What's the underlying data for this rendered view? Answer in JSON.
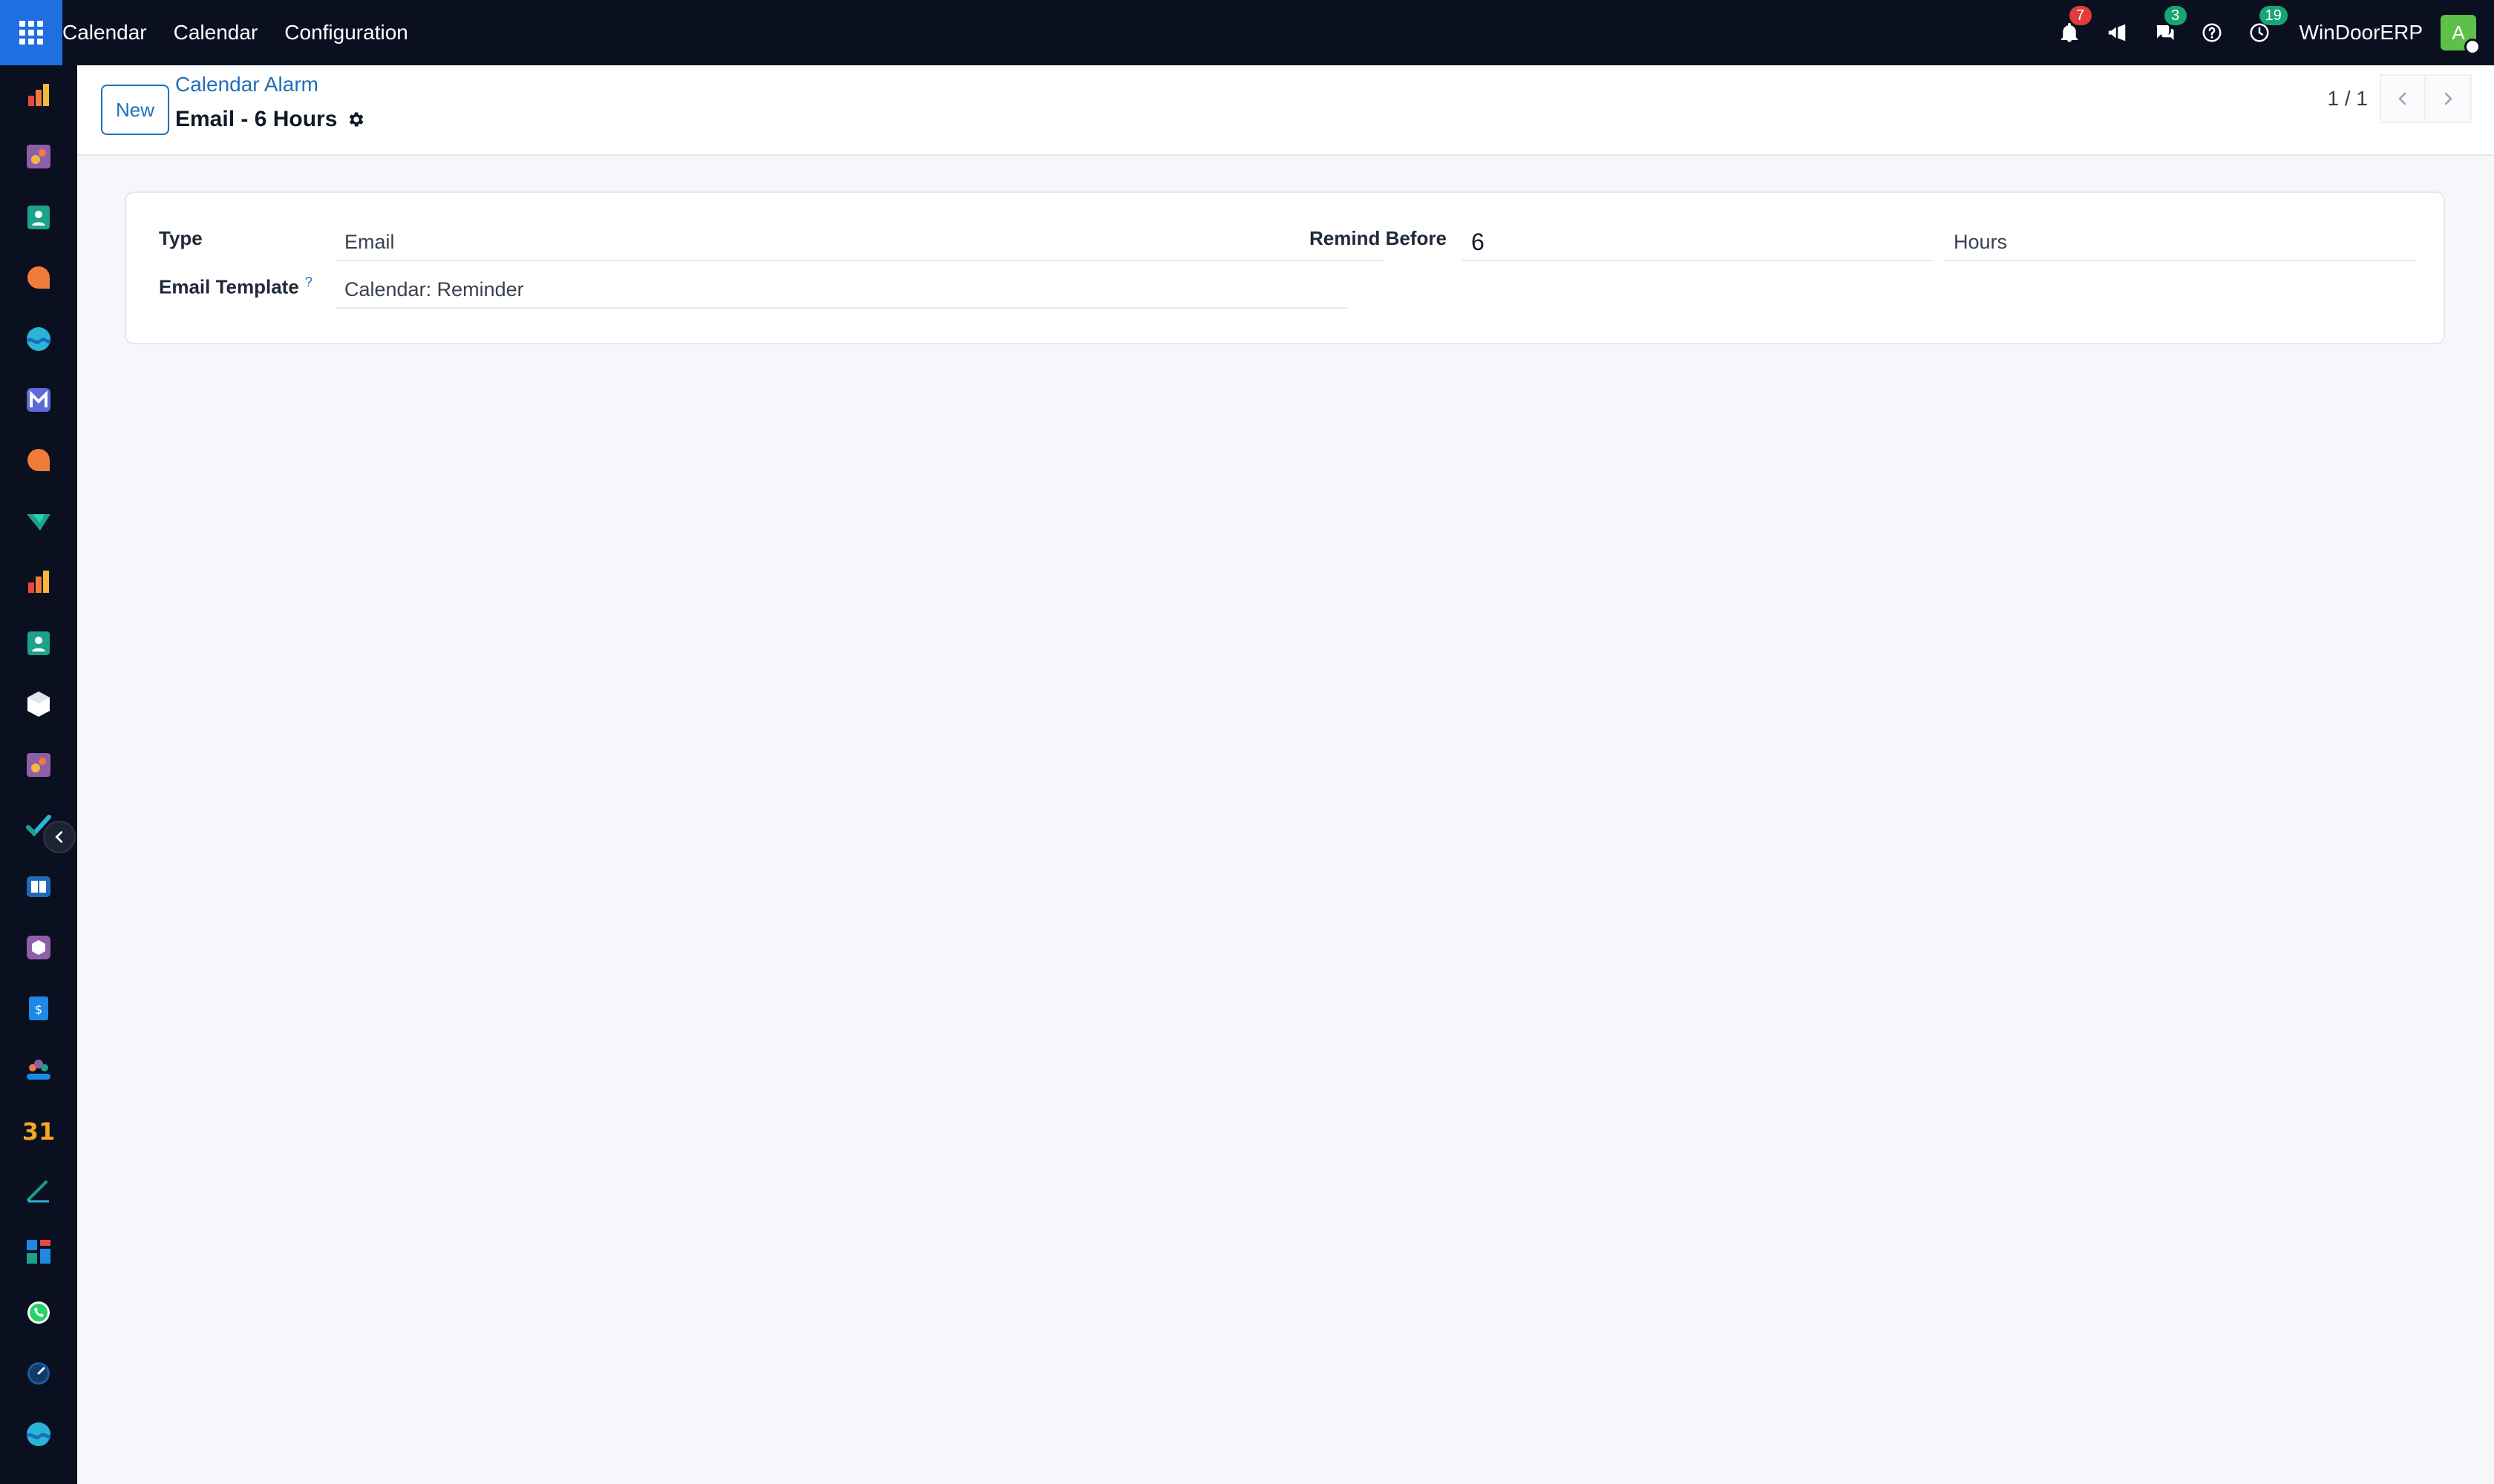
{
  "topbar": {
    "menu": [
      "Calendar",
      "Calendar",
      "Configuration"
    ],
    "notifications_count": "7",
    "messages_count": "3",
    "activities_count": "19",
    "company": "WinDoorERP",
    "avatar_letter": "A"
  },
  "sidebar": {
    "icons": [
      "chart-app-icon",
      "sales-app-icon",
      "contacts-app-icon",
      "chat-app-icon",
      "wave-app-icon",
      "mail-app-icon",
      "discuss-app-icon",
      "delivery-app-icon",
      "reporting-app-icon",
      "contacts2-app-icon",
      "inventory-app-icon",
      "sales2-app-icon",
      "project-app-icon",
      "knowledge-app-icon",
      "product-app-icon",
      "invoicing-app-icon",
      "employees-app-icon",
      "calendar-app-icon",
      "sign-app-icon",
      "dashboards-app-icon",
      "whatsapp-app-icon",
      "timer-app-icon",
      "wave2-app-icon"
    ],
    "calendar_day": "31"
  },
  "control_panel": {
    "new_label": "New",
    "breadcrumb": "Calendar Alarm",
    "title": "Email - 6 Hours",
    "pager": "1 / 1"
  },
  "form": {
    "type_label": "Type",
    "type_value": "Email",
    "email_template_label": "Email Template",
    "email_template_help": "?",
    "email_template_value": "Calendar: Reminder",
    "remind_before_label": "Remind Before",
    "remind_before_value": "6",
    "remind_unit": "Hours"
  },
  "colors": {
    "navbar_bg": "#0b1020",
    "apps_button": "#1f6fe0",
    "link": "#1f6fb8",
    "badge_red": "#e23b3b",
    "badge_green": "#17a673",
    "avatar": "#5fbf4b"
  }
}
